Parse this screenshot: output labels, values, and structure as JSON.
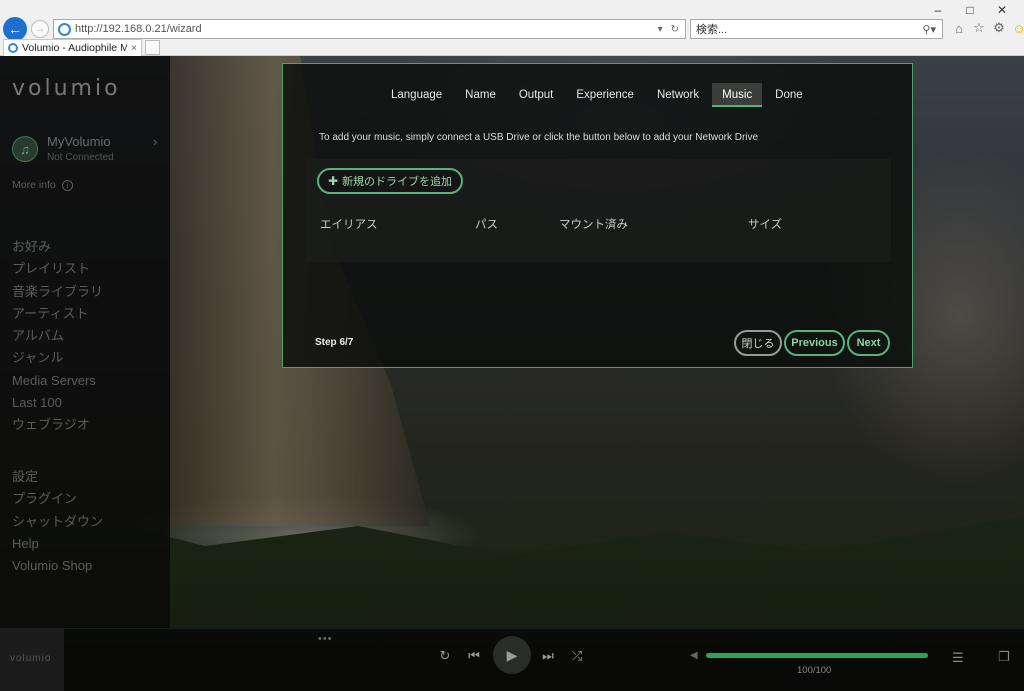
{
  "browser": {
    "url": "http://192.168.0.21/wizard",
    "search_placeholder": "検索...",
    "tab_title": "Volumio - Audiophile Musi...",
    "tab_close": "×",
    "icons": [
      "home-icon",
      "star-icon",
      "gear-icon",
      "smiley-icon"
    ]
  },
  "sidebar": {
    "logo": "volumio",
    "device_name": "MyVolumio",
    "device_status": "Not Connected",
    "more_info": "More info",
    "menu_primary": [
      "お好み",
      "プレイリスト",
      "音楽ライブラリ",
      "アーティスト",
      "アルバム",
      "ジャンル",
      "Media Servers",
      "Last 100",
      "ウェブラジオ"
    ],
    "menu_secondary": [
      "設定",
      "プラグイン",
      "シャットダウン",
      "Help",
      "Volumio Shop"
    ]
  },
  "wizard": {
    "steps": [
      "Language",
      "Name",
      "Output",
      "Experience",
      "Network",
      "Music",
      "Done"
    ],
    "active_step": "Music",
    "instruction": "To add your music, simply connect a USB Drive or click the button below to add your Network Drive",
    "add_drive_label": "新規のドライブを追加",
    "columns": [
      "エイリアス",
      "パス",
      "マウント済み",
      "サイズ"
    ],
    "step_counter": "Step 6/7",
    "buttons": {
      "close": "閉じる",
      "previous": "Previous",
      "next": "Next"
    }
  },
  "player": {
    "logo": "volumio",
    "dots": "•••",
    "volume_text": "100/100",
    "volume_level": 100
  },
  "colors": {
    "accent": "#56b37a",
    "volume_fill": "#2fa355",
    "browser_blue": "#1f6fd1"
  }
}
